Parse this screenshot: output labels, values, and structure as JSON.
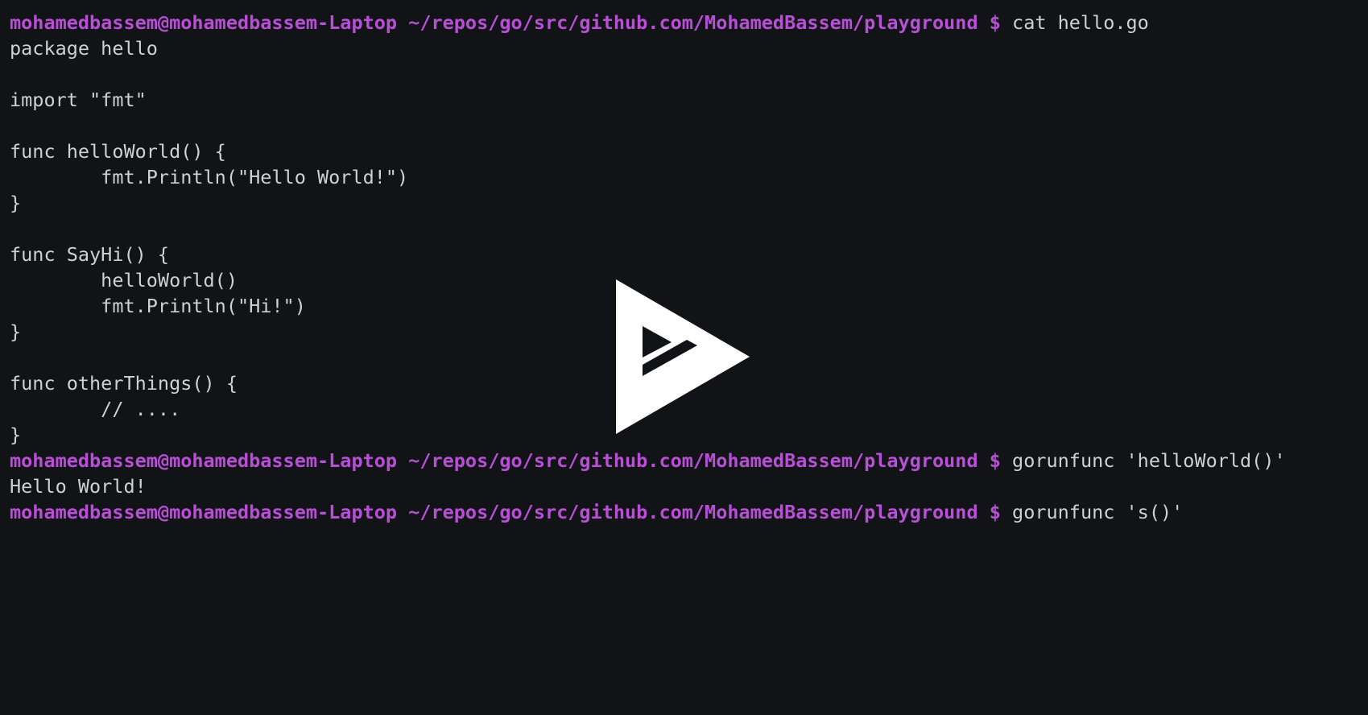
{
  "colors": {
    "background": "#121316",
    "text": "#d0d0d0",
    "prompt": "#b84fd6",
    "logo": "#ffffff"
  },
  "terminal": {
    "lines": [
      {
        "type": "prompt",
        "prompt": "mohamedbassem@mohamedbassem-Laptop ~/repos/go/src/github.com/MohamedBassem/playground $",
        "command": " cat hello.go"
      },
      {
        "type": "output",
        "text": "package hello"
      },
      {
        "type": "output",
        "text": ""
      },
      {
        "type": "output",
        "text": "import \"fmt\""
      },
      {
        "type": "output",
        "text": ""
      },
      {
        "type": "output",
        "text": "func helloWorld() {"
      },
      {
        "type": "output",
        "text": "        fmt.Println(\"Hello World!\")"
      },
      {
        "type": "output",
        "text": "}"
      },
      {
        "type": "output",
        "text": ""
      },
      {
        "type": "output",
        "text": "func SayHi() {"
      },
      {
        "type": "output",
        "text": "        helloWorld()"
      },
      {
        "type": "output",
        "text": "        fmt.Println(\"Hi!\")"
      },
      {
        "type": "output",
        "text": "}"
      },
      {
        "type": "output",
        "text": ""
      },
      {
        "type": "output",
        "text": "func otherThings() {"
      },
      {
        "type": "output",
        "text": "        // ...."
      },
      {
        "type": "output",
        "text": "}"
      },
      {
        "type": "prompt",
        "prompt": "mohamedbassem@mohamedbassem-Laptop ~/repos/go/src/github.com/MohamedBassem/playground $",
        "command": " gorunfunc 'helloWorld()'"
      },
      {
        "type": "output",
        "text": "Hello World!"
      },
      {
        "type": "prompt",
        "prompt": "mohamedbassem@mohamedbassem-Laptop ~/repos/go/src/github.com/MohamedBassem/playground $",
        "command": " gorunfunc 's()'"
      }
    ]
  },
  "overlay": {
    "icon": "asciinema-play-icon"
  }
}
